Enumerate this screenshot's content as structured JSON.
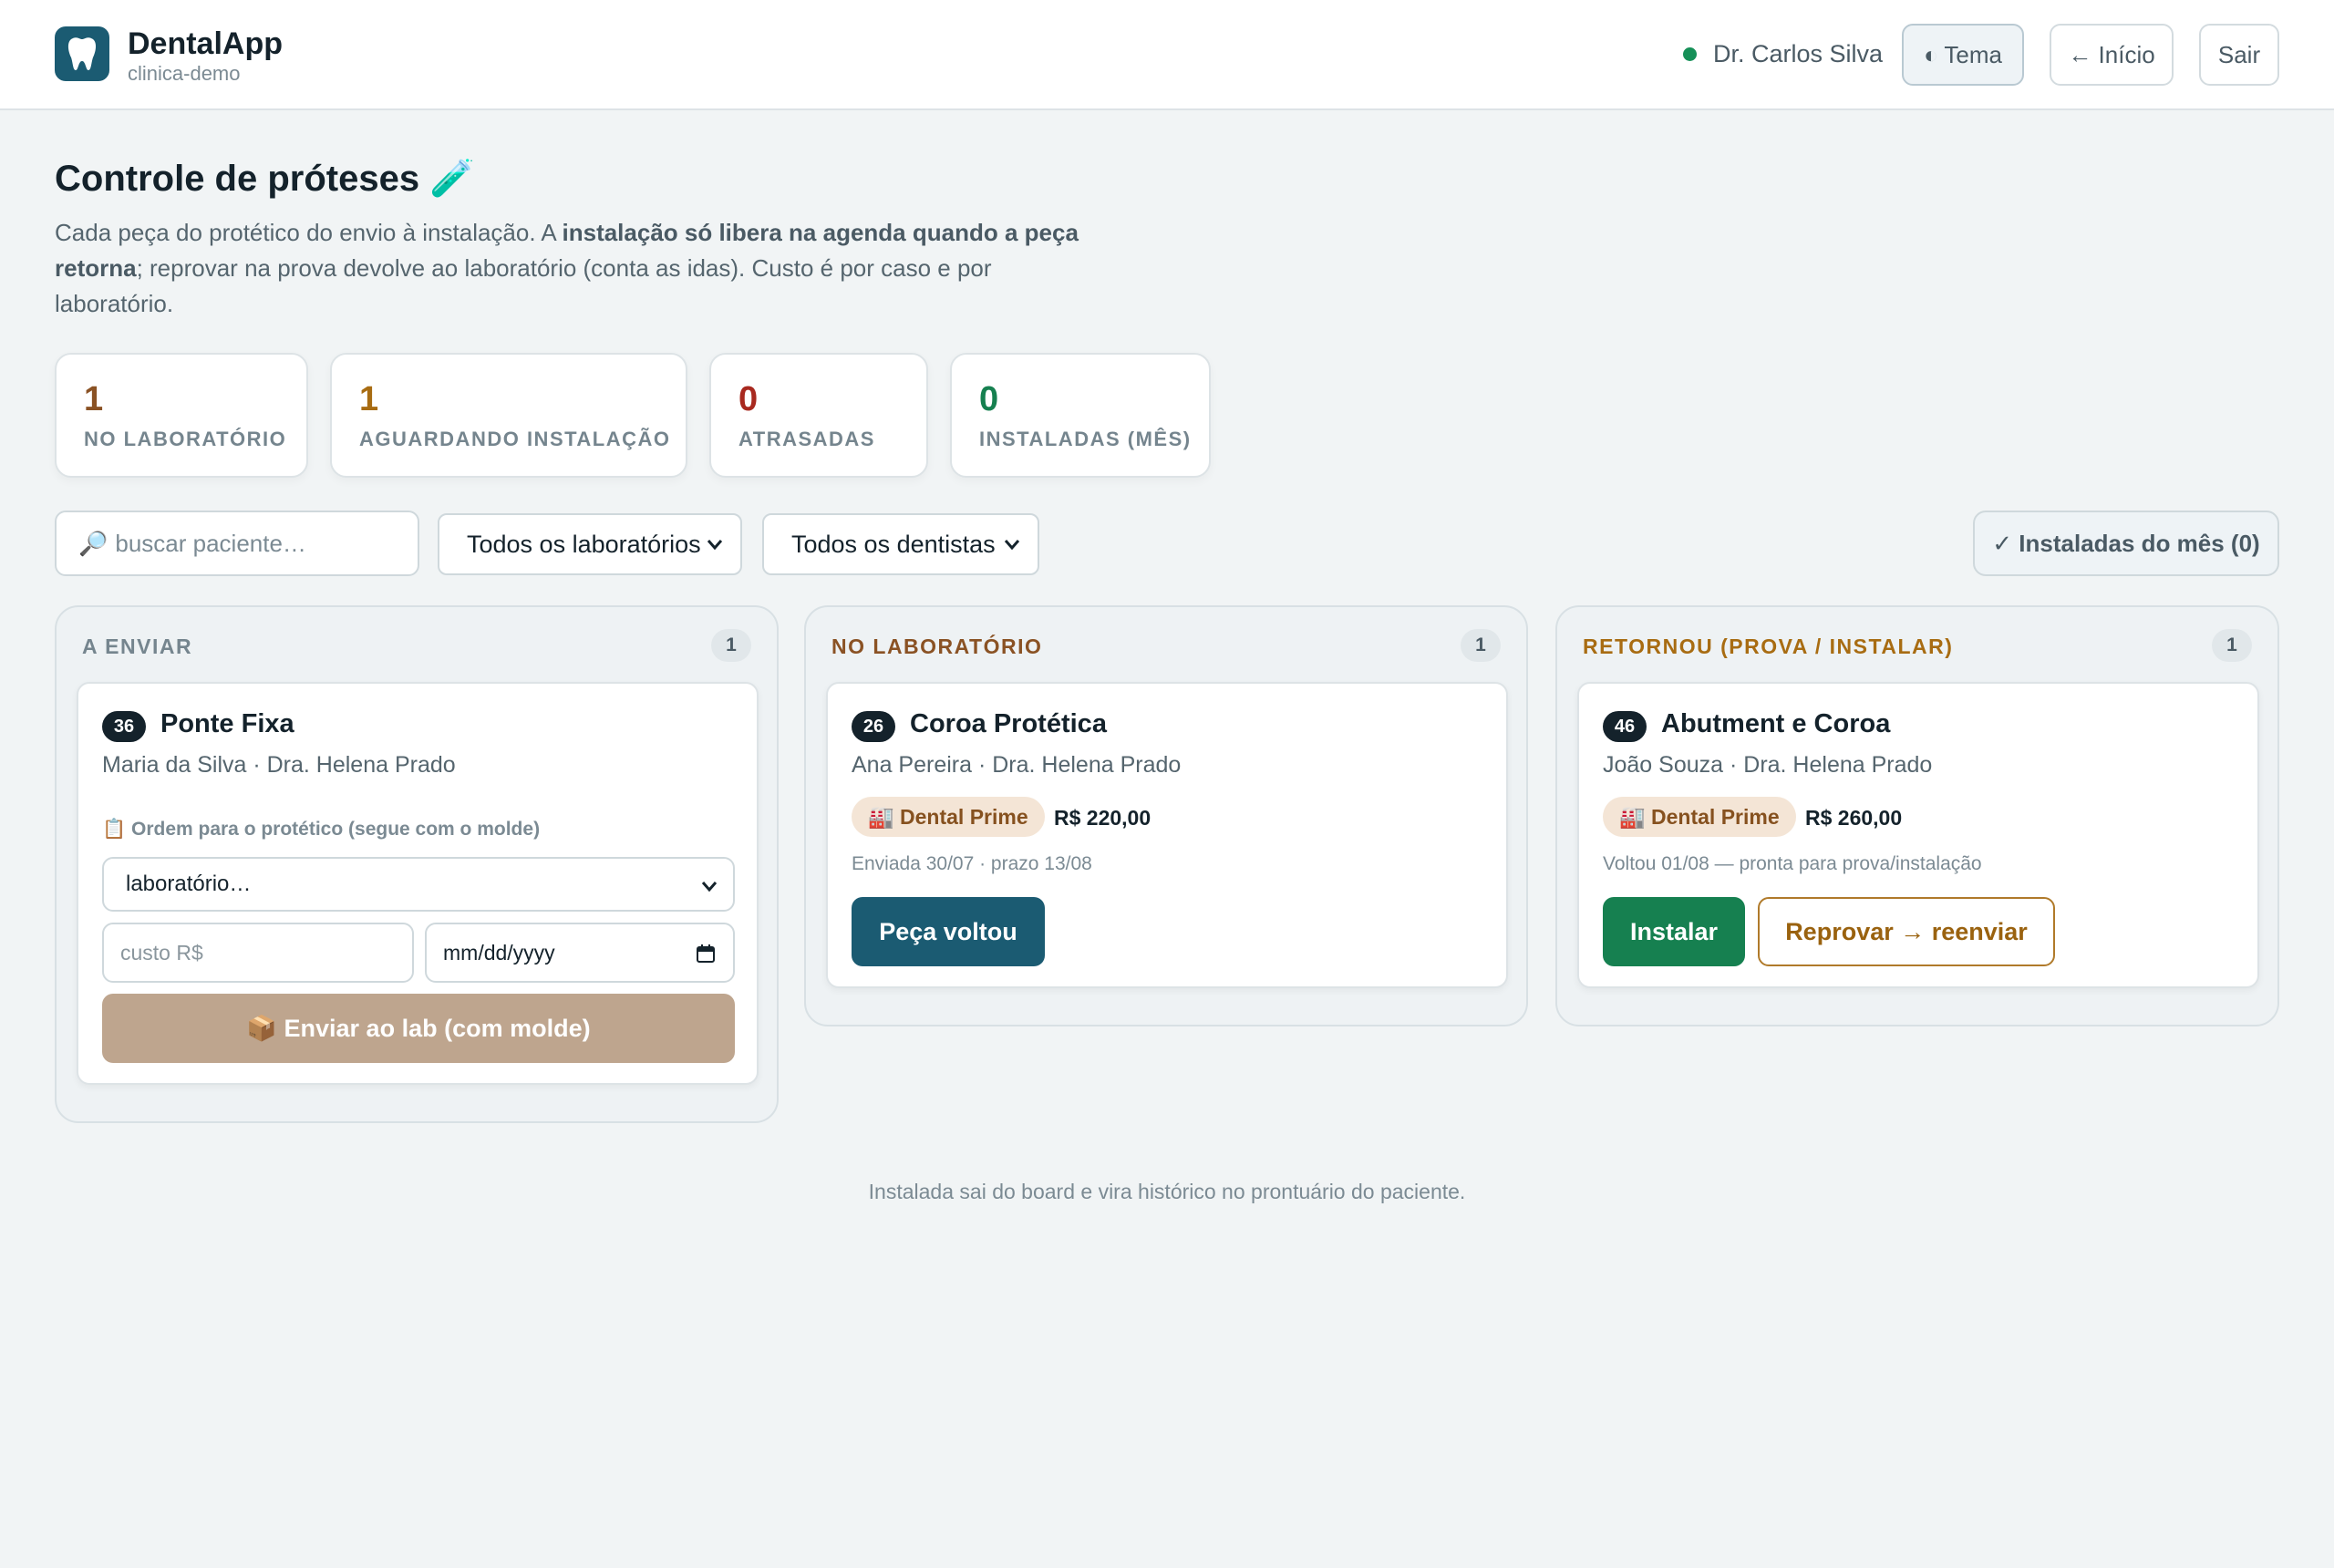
{
  "header": {
    "app_name": "DentalApp",
    "workspace": "clinica-demo",
    "user_name": "Dr. Carlos Silva",
    "tema_label": "◐ Tema",
    "inicio_label": "← Início",
    "sair_label": "Sair"
  },
  "page": {
    "title": "Controle de próteses 🧪",
    "desc_part1": "Cada peça do protético do envio à instalação. A ",
    "desc_bold": "instalação só libera na agenda quando a peça retorna",
    "desc_part2": "; reprovar na prova devolve ao laboratório (conta as idas). Custo é por caso e por laboratório."
  },
  "stats": [
    {
      "value": "1",
      "label": "NO LABORATÓRIO",
      "color": "#8a5224"
    },
    {
      "value": "1",
      "label": "AGUARDANDO INSTALAÇÃO",
      "color": "#a86c12"
    },
    {
      "value": "0",
      "label": "ATRASADAS",
      "color": "#a8291f"
    },
    {
      "value": "0",
      "label": "INSTALADAS (MÊS)",
      "color": "#168050"
    }
  ],
  "filters": {
    "search_placeholder": "buscar paciente…",
    "lab_select": "Todos os laboratórios",
    "dentist_select": "Todos os dentistas",
    "installed_button": "✓ Instaladas do mês (0)"
  },
  "columns": [
    {
      "title": "A ENVIAR",
      "count": "1",
      "color": "#75858e",
      "card": {
        "tooth": "36",
        "title": "Ponte Fixa",
        "subtitle": "Maria da Silva · Dra. Helena Prado",
        "order_label": "📋 Ordem para o protético (segue com o molde)",
        "lab_select": "laboratório…",
        "cost_placeholder": "custo R$",
        "date_placeholder": "mm/dd/yyyy",
        "send_button": "📦 Enviar ao lab (com molde)"
      }
    },
    {
      "title": "NO LABORATÓRIO",
      "count": "1",
      "color": "#8a5224",
      "card": {
        "tooth": "26",
        "title": "Coroa Protética",
        "subtitle": "Ana Pereira · Dra. Helena Prado",
        "lab": "🏭 Dental Prime",
        "price": "R$ 220,00",
        "note": "Enviada 30/07 · prazo 13/08",
        "action": "Peça voltou"
      }
    },
    {
      "title": "RETORNOU (PROVA / INSTALAR)",
      "count": "1",
      "color": "#a86c12",
      "card": {
        "tooth": "46",
        "title": "Abutment e Coroa",
        "subtitle": "João Souza · Dra. Helena Prado",
        "lab": "🏭 Dental Prime",
        "price": "R$ 260,00",
        "note": "Voltou 01/08 — pronta para prova/instalação",
        "install_button": "Instalar",
        "reject_button": "Reprovar → reenviar"
      }
    }
  ],
  "footnote": "Instalada sai do board e vira histórico no prontuário do paciente."
}
